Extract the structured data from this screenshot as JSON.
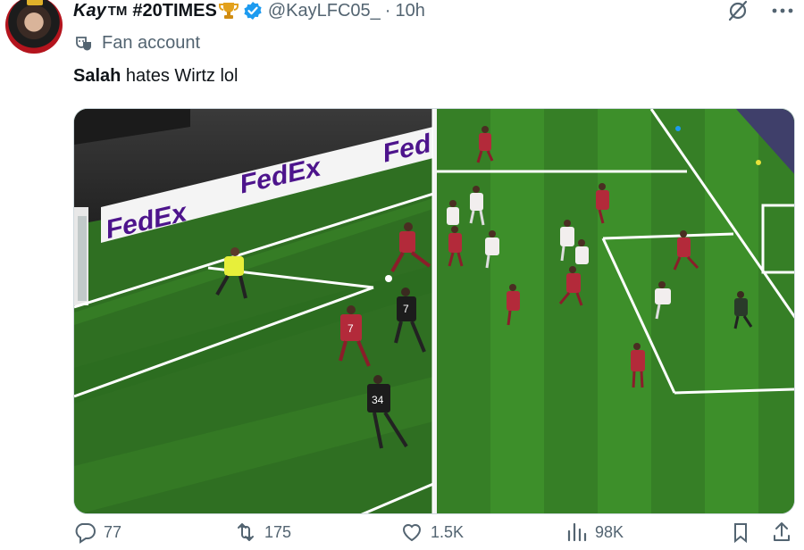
{
  "tweet": {
    "display_name": "Kay",
    "display_tm": "TM",
    "display_tag": "#20TIMES",
    "handle": "@KayLFC05_",
    "separator": "·",
    "time": "10h",
    "label": "Fan account",
    "text_bold": "Salah",
    "text_rest": " hates Wirtz lol"
  },
  "stats": {
    "replies": "77",
    "reposts": "175",
    "likes": "1.5K",
    "views": "98K"
  },
  "media": {
    "left_ads": [
      "FedEx",
      "FedEx",
      "FedEx"
    ],
    "shirt_numbers": [
      "7",
      "7",
      "34"
    ]
  },
  "colors": {
    "verified": "#1d9bf0",
    "secondary_text": "#536471",
    "pitch_dark": "#2b6a1f",
    "pitch_light": "#3c8a28",
    "liverpool": "#b32a3a",
    "fedex_purple": "#4d148c",
    "fedex_orange": "#ff6600"
  },
  "icons": {
    "trophy": "trophy-icon",
    "verified": "verified-badge-icon",
    "grok": "grok-icon",
    "more": "more-icon",
    "fan_mask": "theater-mask-icon",
    "reply": "reply-icon",
    "repost": "repost-icon",
    "like": "heart-icon",
    "views": "views-icon",
    "bookmark": "bookmark-icon",
    "share": "share-icon"
  }
}
